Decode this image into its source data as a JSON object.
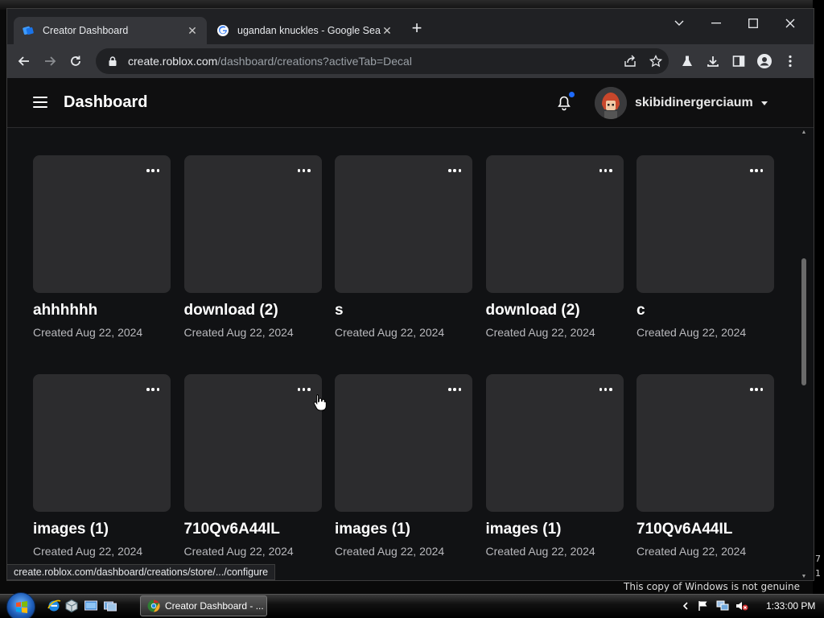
{
  "desktop": {
    "watermark": "This copy of Windows is not genuine",
    "right_ticks": [
      "7",
      "1"
    ]
  },
  "browser": {
    "tabs": [
      {
        "title": "Creator Dashboard",
        "active": true,
        "favicon": "roblox-studio-icon"
      },
      {
        "title": "ugandan knuckles - Google Sear",
        "active": false,
        "favicon": "google-icon"
      }
    ],
    "url_host": "create.roblox.com",
    "url_path": "/dashboard/creations?activeTab=Decal",
    "status_url": "create.roblox.com/dashboard/creations/store/.../configure"
  },
  "header": {
    "title": "Dashboard",
    "username": "skibidinergerciaum",
    "notification_dot_color": "#1e6bff"
  },
  "creations": [
    {
      "name": "ahhhhhh",
      "created": "Created Aug 22, 2024"
    },
    {
      "name": "download (2)",
      "created": "Created Aug 22, 2024"
    },
    {
      "name": "s",
      "created": "Created Aug 22, 2024"
    },
    {
      "name": "download (2)",
      "created": "Created Aug 22, 2024"
    },
    {
      "name": "c",
      "created": "Created Aug 22, 2024"
    },
    {
      "name": "images (1)",
      "created": "Created Aug 22, 2024"
    },
    {
      "name": "710Qv6A44IL",
      "created": "Created Aug 22, 2024"
    },
    {
      "name": "images (1)",
      "created": "Created Aug 22, 2024"
    },
    {
      "name": "images (1)",
      "created": "Created Aug 22, 2024"
    },
    {
      "name": "710Qv6A44IL",
      "created": "Created Aug 22, 2024"
    }
  ],
  "taskbar": {
    "active_task": "Creator Dashboard - ...",
    "clock": "1:33:00 PM"
  }
}
